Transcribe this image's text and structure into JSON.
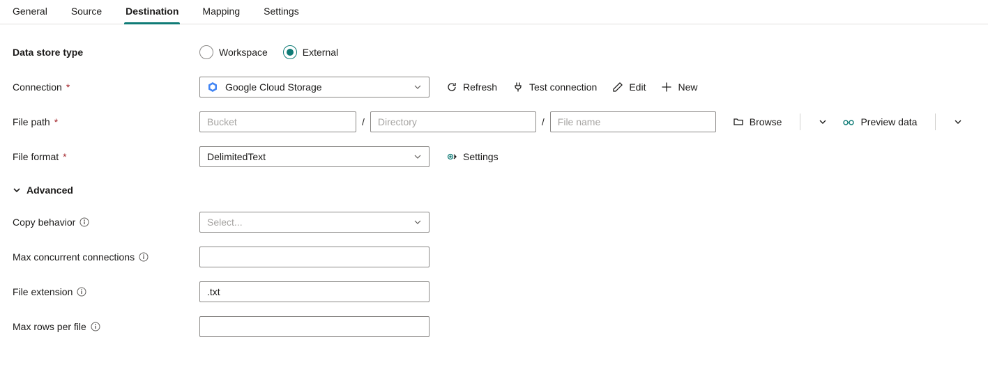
{
  "tabs": {
    "general": "General",
    "source": "Source",
    "destination": "Destination",
    "mapping": "Mapping",
    "settings": "Settings",
    "active": "destination"
  },
  "labels": {
    "data_store_type": "Data store type",
    "connection": "Connection",
    "file_path": "File path",
    "file_format": "File format",
    "advanced": "Advanced",
    "copy_behavior": "Copy behavior",
    "max_concurrent": "Max concurrent connections",
    "file_extension": "File extension",
    "max_rows_per_file": "Max rows per file"
  },
  "data_store_type": {
    "workspace": "Workspace",
    "external": "External",
    "selected": "external"
  },
  "connection": {
    "value": "Google Cloud Storage",
    "actions": {
      "refresh": "Refresh",
      "test": "Test connection",
      "edit": "Edit",
      "new": "New"
    }
  },
  "file_path": {
    "bucket_placeholder": "Bucket",
    "bucket_value": "",
    "directory_placeholder": "Directory",
    "directory_value": "",
    "filename_placeholder": "File name",
    "filename_value": "",
    "browse": "Browse",
    "preview": "Preview data"
  },
  "file_format": {
    "value": "DelimitedText",
    "settings": "Settings"
  },
  "copy_behavior": {
    "value": "",
    "placeholder": "Select..."
  },
  "max_concurrent": {
    "value": ""
  },
  "file_extension": {
    "value": ".txt"
  },
  "max_rows_per_file": {
    "value": ""
  }
}
